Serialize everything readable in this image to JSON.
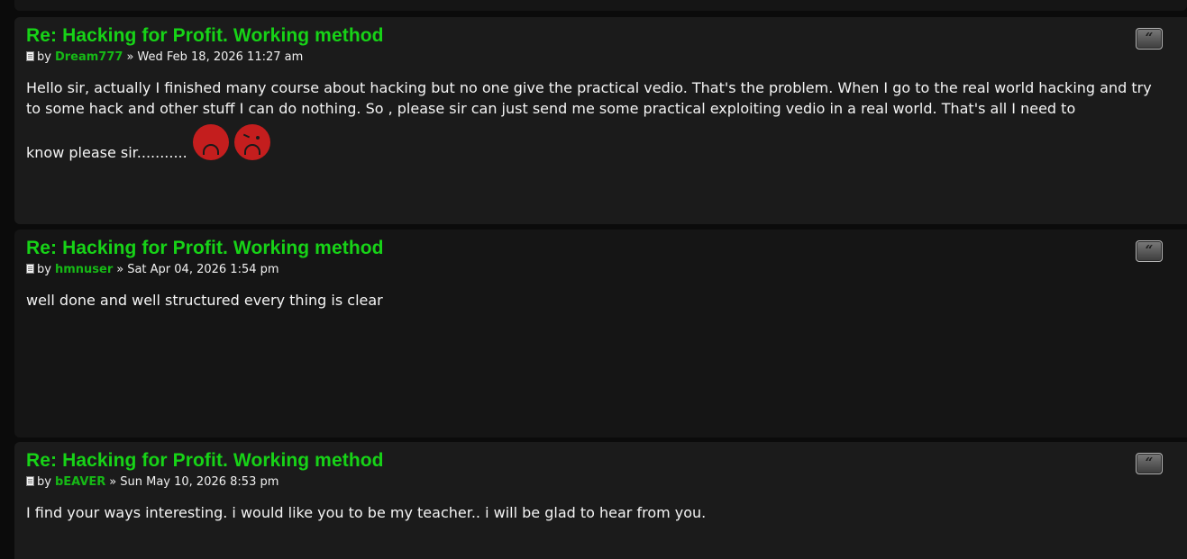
{
  "posts": [
    {
      "title": "Re: Hacking for Profit. Working method",
      "by": "by",
      "author": "Dream777",
      "separator": "»",
      "date": "Wed Feb 18, 2026 11:27 am",
      "body": {
        "line1": "Hello sir, actually I finished many course about hacking but no one give the practical vedio. That's the problem. When I go to the real world hacking and",
        "line2": "try to some hack and other stuff I can do nothing. So , please sir can just send me some practical exploiting vedio in a real world. That's all I need to",
        "line3": "know please sir..........."
      },
      "smilies": [
        "sad-face",
        "sad-face"
      ],
      "quote_icon": "quote-icon"
    },
    {
      "title": "Re: Hacking for Profit. Working method",
      "by": "by",
      "author": "hmnuser",
      "separator": "»",
      "date": "Sat Apr 04, 2026 1:54 pm",
      "body": {
        "line1": "well done and well structured every thing is clear"
      },
      "quote_icon": "quote-icon"
    },
    {
      "title": "Re: Hacking for Profit. Working method",
      "by": "by",
      "author": "bEAVER",
      "separator": "»",
      "date": "Sun May 10, 2026 8:53 pm",
      "body": {
        "line1": "I find your ways interesting. i would like you to be my teacher.. i will be glad to hear from you."
      },
      "quote_icon": "quote-icon"
    }
  ],
  "colors": {
    "page_bg": "#0b0b0b",
    "post_bg": "#1b1b1b",
    "post_bg_alt": "#151515",
    "title": "#17d317",
    "author": "#16b916",
    "text": "#f4f4f4",
    "smiley": "#c41e1e"
  }
}
